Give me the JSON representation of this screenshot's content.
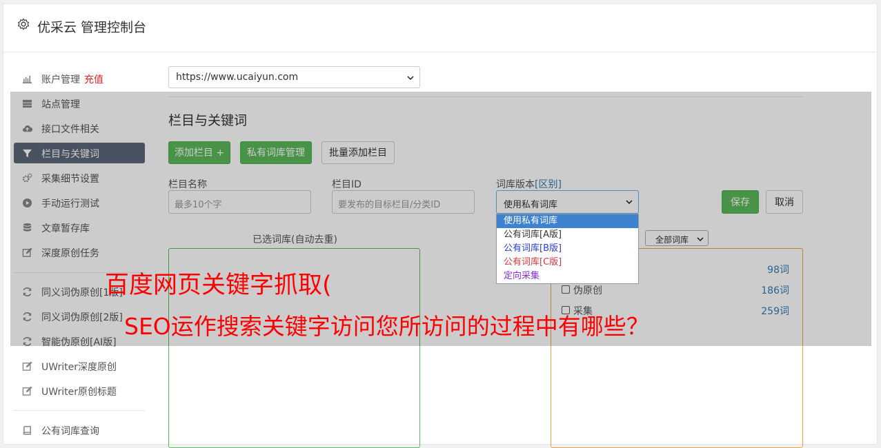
{
  "header": {
    "title": "优采云 管理控制台"
  },
  "sidebar": {
    "items": [
      {
        "label": "账户管理",
        "extra": "充值",
        "icon": "bar-chart-icon"
      },
      {
        "label": "站点管理",
        "icon": "server-icon"
      },
      {
        "label": "接口文件相关",
        "icon": "cloud-upload-icon"
      },
      {
        "label": "栏目与关键词",
        "icon": "filter-icon",
        "active": true
      },
      {
        "label": "采集细节设置",
        "icon": "cogs-icon"
      },
      {
        "label": "手动运行测试",
        "icon": "play-circle-icon"
      },
      {
        "label": "文章暂存库",
        "icon": "database-icon"
      },
      {
        "label": "深度原创任务",
        "icon": "edit-icon"
      },
      {
        "label": "同义词伪原创[1版]",
        "icon": "refresh-icon"
      },
      {
        "label": "同义词伪原创[2版]",
        "icon": "refresh-icon"
      },
      {
        "label": "智能伪原创[AI版]",
        "icon": "refresh-icon"
      },
      {
        "label": "UWriter深度原创",
        "icon": "edit-icon"
      },
      {
        "label": "UWriter原创标题",
        "icon": "edit-icon"
      },
      {
        "label": "公有词库查询",
        "icon": "book-icon"
      }
    ]
  },
  "site_select": {
    "value": "https://www.ucaiyun.com"
  },
  "section": {
    "title": "栏目与关键词",
    "add_column": "添加栏目 +",
    "private_lib": "私有词库管理",
    "batch_add": "批量添加栏目"
  },
  "form": {
    "name_label": "栏目名称",
    "name_placeholder": "最多10个字",
    "id_label": "栏目ID",
    "id_placeholder": "要发布的目标栏目/分类ID",
    "version_label": "词库版本",
    "version_link": "[区别]",
    "version_value": "使用私有词库",
    "save": "保存",
    "cancel": "取消"
  },
  "dropdown": {
    "options": [
      {
        "label": "使用私有词库",
        "color": "#ffffff",
        "selected": true
      },
      {
        "label": "公有词库[A版]",
        "color": "#333333"
      },
      {
        "label": "公有词库[B版]",
        "color": "#2a3bd6"
      },
      {
        "label": "公有词库[C版]",
        "color": "#d9363e"
      },
      {
        "label": "定向采集",
        "color": "#8a2be2"
      }
    ]
  },
  "left_panel": {
    "title": "已选词库(自动去重)"
  },
  "right_panel": {
    "filter": "全部词库",
    "rows": [
      {
        "name": "",
        "count": "98词"
      },
      {
        "name": "伪原创",
        "count": "186词"
      },
      {
        "name": "采集",
        "count": "259词"
      }
    ]
  },
  "headline": {
    "line1": "百度网页关键字抓取(",
    "line2": "SEO运作搜索关键字访问您所访问的过程中有哪些？"
  }
}
